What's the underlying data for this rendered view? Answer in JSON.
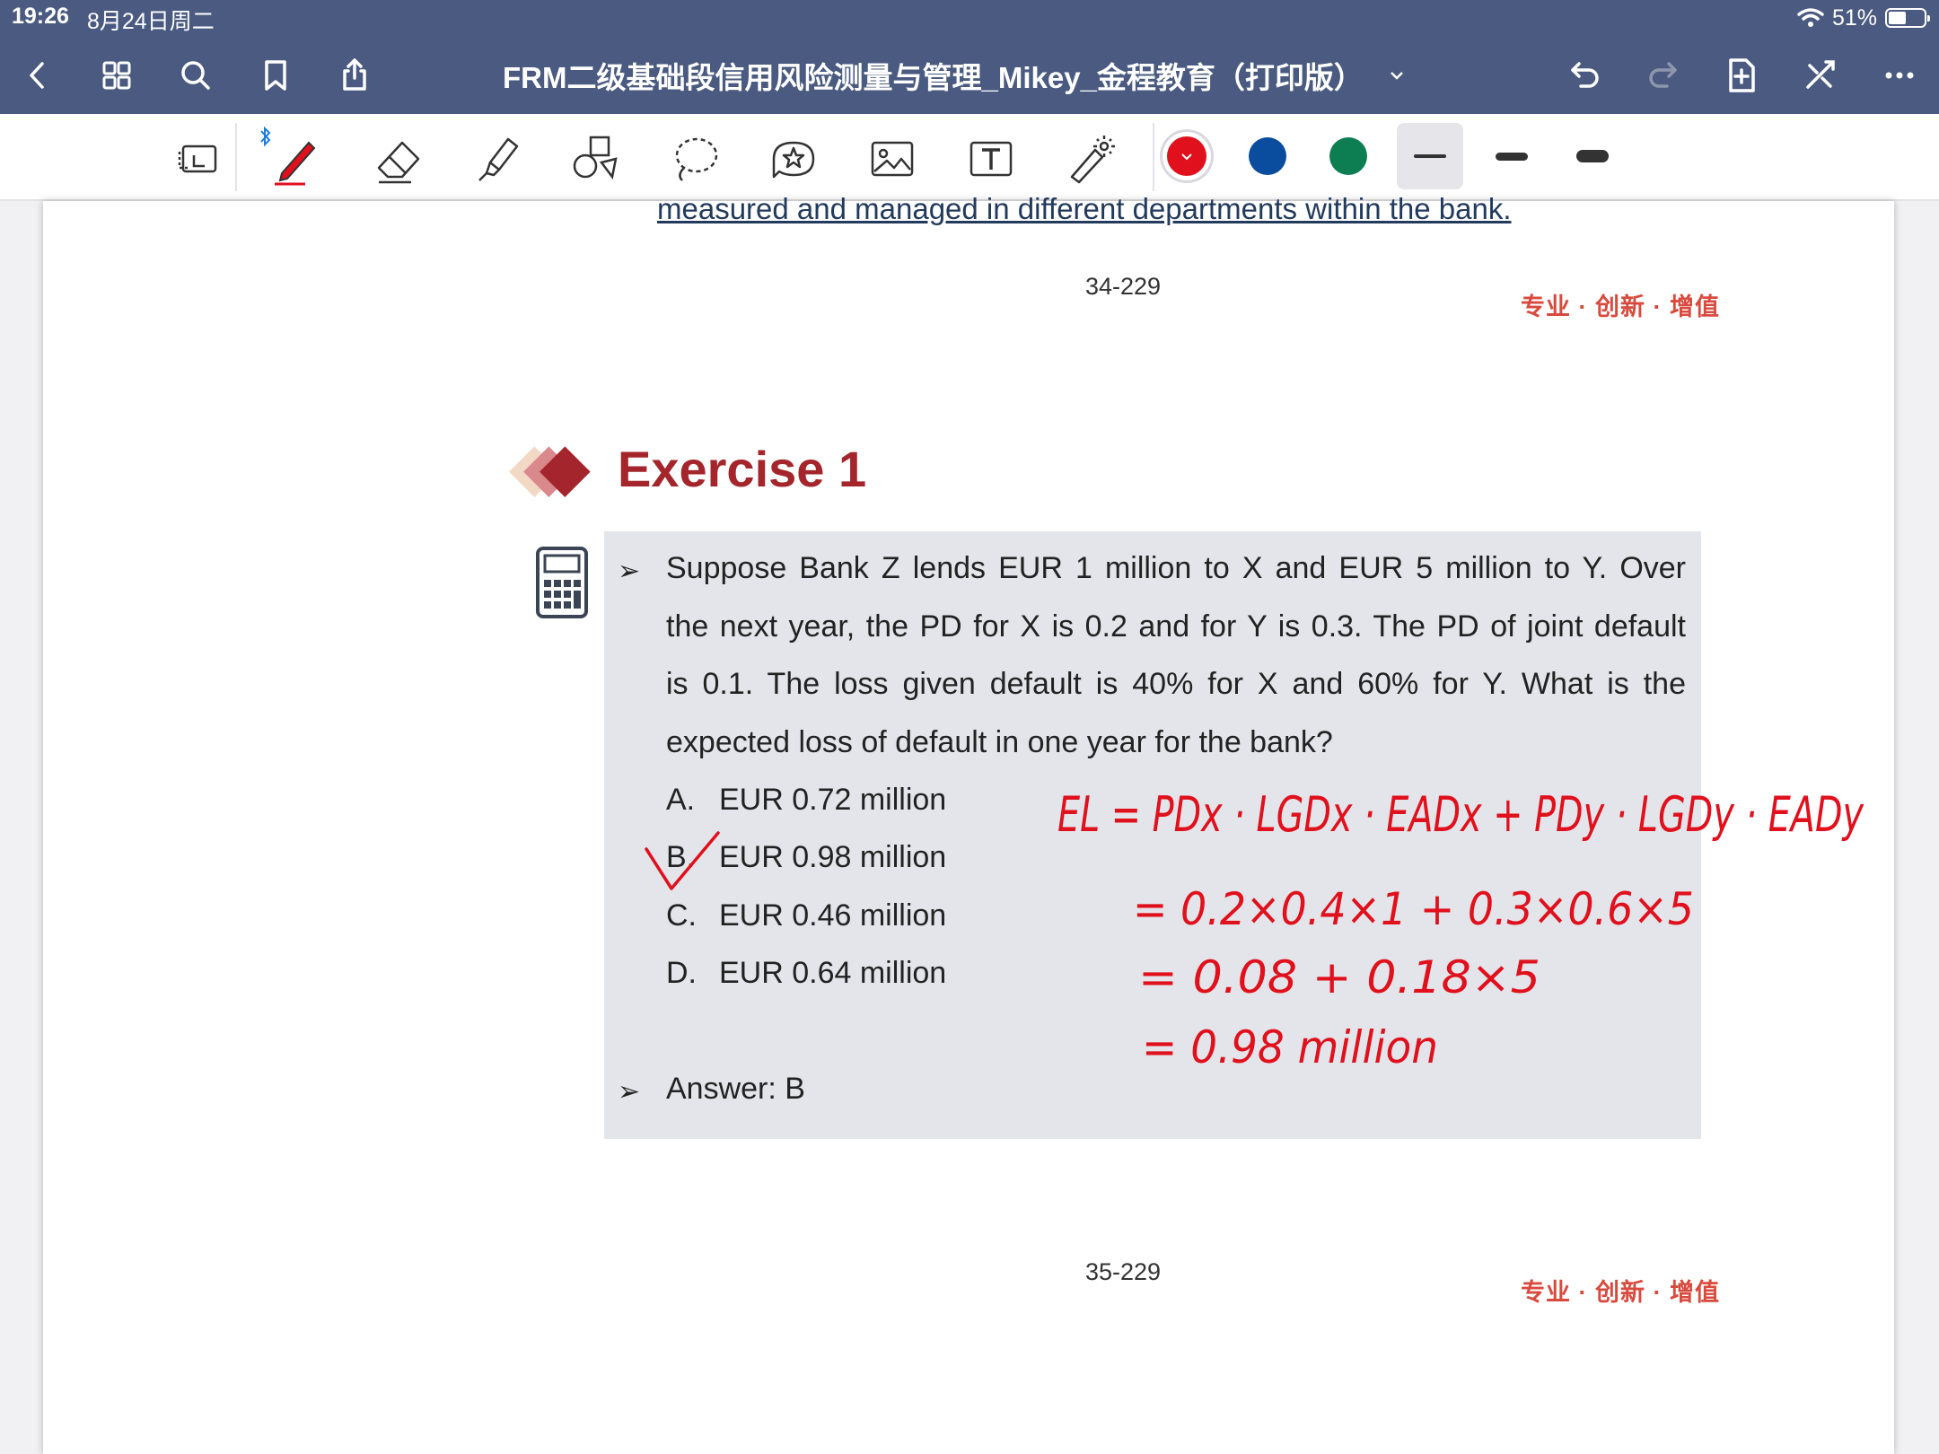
{
  "status": {
    "time": "19:26",
    "date": "8月24日周二",
    "battery": "51%",
    "battery_level": 0.51
  },
  "nav": {
    "title": "FRM二级基础段信用风险测量与管理_Mikey_金程教育（打印版）",
    "icons": [
      "chevron-left-icon",
      "grid-icon",
      "search-icon",
      "bookmark-icon",
      "share-icon",
      "undo-icon",
      "redo-icon",
      "add-page-icon",
      "close-tools-icon",
      "more-icon"
    ]
  },
  "toolbar": {
    "tools": [
      "lasso-page-icon",
      "pen-icon",
      "eraser-icon",
      "highlighter-icon",
      "shapes-icon",
      "lasso-icon",
      "sticker-icon",
      "image-icon",
      "text-box-icon",
      "laser-pointer-icon"
    ],
    "colors": [
      "#e0101c",
      "#0a4c9e",
      "#0d7e52"
    ],
    "selected_color": "#e0101c"
  },
  "page": {
    "previous_text": "measured and managed in different departments within the bank.",
    "page_number_top": "34-229",
    "watermark": "专业 · 创新 · 增值",
    "exercise_title": "Exercise 1",
    "question_lines": [
      "Suppose Bank Z lends EUR 1 million to X and EUR 5 million to Y. Over",
      "the next year, the PD for X is 0.2 and for Y is 0.3. The PD of joint default",
      "is 0.1. The loss given default is 40% for X and 60% for Y. What is the",
      "expected loss of default in one year for the bank?"
    ],
    "options": [
      {
        "letter": "A.",
        "text": "EUR 0.72 million"
      },
      {
        "letter": "B.",
        "text": "EUR 0.98 million"
      },
      {
        "letter": "C.",
        "text": "EUR 0.46 million"
      },
      {
        "letter": "D.",
        "text": "EUR 0.64 million"
      }
    ],
    "answer": "Answer: B",
    "page_number_bottom": "35-229"
  },
  "handwriting": {
    "line1": "EL = PDx · LGDx · EADx + PDy · LGDy · EADy",
    "line2": "= 0.2×0.4×1 + 0.3×0.6×5",
    "line3": "= 0.08 + 0.18×5",
    "line4": "= 0.98 million"
  }
}
